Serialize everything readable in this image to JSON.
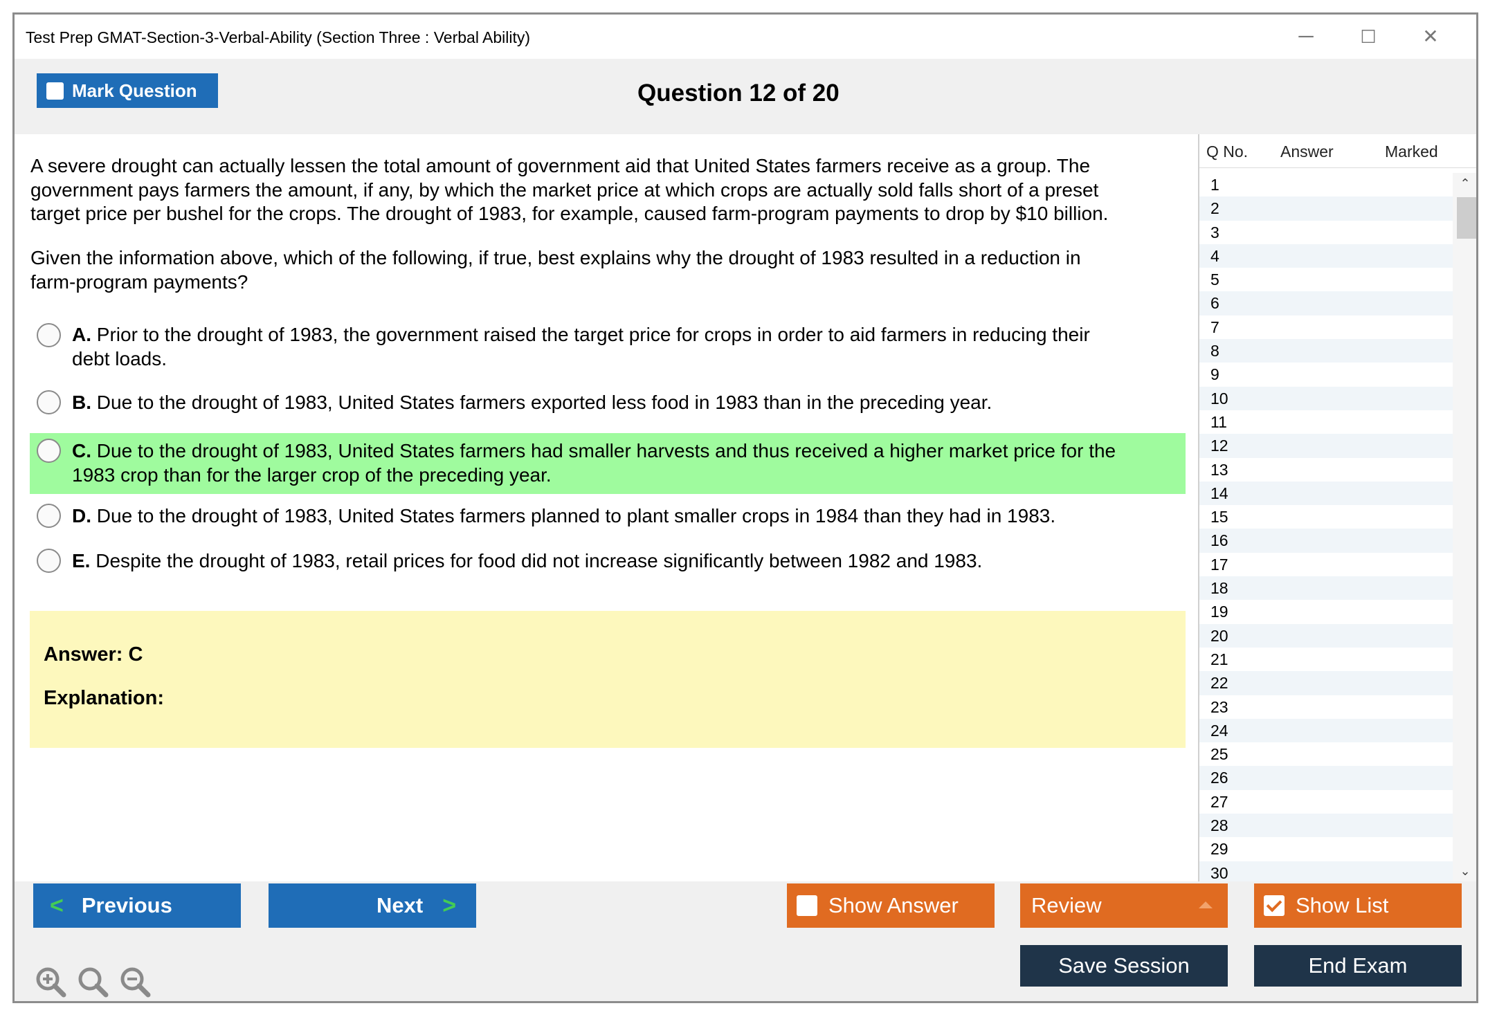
{
  "window": {
    "title": "Test Prep GMAT-Section-3-Verbal-Ability (Section Three : Verbal Ability)",
    "controls": {
      "minimize": "─",
      "maximize": "☐",
      "close": "✕"
    }
  },
  "header": {
    "mark_question_label": "Mark Question",
    "question_counter": "Question 12 of 20"
  },
  "question": {
    "stimulus_lines": [
      "A severe drought can actually lessen the total amount of government aid that United States farmers receive as a group. The",
      "government pays farmers the amount, if any, by which the market price at which crops are actually sold falls short of a preset",
      "target price per bushel for the crops. The drought of 1983, for example, caused farm-program payments to drop by $10 billion."
    ],
    "prompt_lines": [
      "Given the information above, which of the following, if true, best explains why the drought of 1983 resulted in a reduction in",
      "farm-program payments?"
    ],
    "choices": [
      {
        "letter": "A.",
        "lines": [
          "Prior to the drought of 1983, the government raised the target price for crops in order to aid farmers in reducing their",
          "debt loads."
        ],
        "correct": false
      },
      {
        "letter": "B.",
        "lines": [
          "Due to the drought of 1983, United States farmers exported less food in 1983 than in the preceding year."
        ],
        "correct": false
      },
      {
        "letter": "C.",
        "lines": [
          "Due to the drought of 1983, United States farmers had smaller harvests and thus received a higher market price for the",
          "1983 crop than for the larger crop of the preceding year."
        ],
        "correct": true
      },
      {
        "letter": "D.",
        "lines": [
          "Due to the drought of 1983, United States farmers planned to plant smaller crops in 1984 than they had in 1983."
        ],
        "correct": false
      },
      {
        "letter": "E.",
        "lines": [
          "Despite the drought of 1983, retail prices for food did not increase significantly between 1982 and 1983."
        ],
        "correct": false
      }
    ],
    "highlight_color": "#9ffb9e"
  },
  "answer_panel": {
    "answer_label": "Answer: C",
    "explanation_label": "Explanation:",
    "background": "#fdf8bd"
  },
  "question_list": {
    "headers": {
      "qno": "Q No.",
      "answer": "Answer",
      "marked": "Marked"
    },
    "rows": [
      "1",
      "2",
      "3",
      "4",
      "5",
      "6",
      "7",
      "8",
      "9",
      "10",
      "11",
      "12",
      "13",
      "14",
      "15",
      "16",
      "17",
      "18",
      "19",
      "20",
      "21",
      "22",
      "23",
      "24",
      "25",
      "26",
      "27",
      "28",
      "29",
      "30"
    ]
  },
  "footer": {
    "previous_label": "Previous",
    "next_label": "Next",
    "show_answer_label": "Show Answer",
    "review_label": "Review",
    "show_list_label": "Show List",
    "save_session_label": "Save Session",
    "end_exam_label": "End Exam",
    "icons": [
      "zoom-in-icon",
      "zoom-reset-icon",
      "zoom-out-icon"
    ]
  },
  "colors": {
    "blue_button": "#1f6db7",
    "orange_button": "#e06b21",
    "navy_button": "#1f3449",
    "arrow_green": "#44cc55"
  }
}
